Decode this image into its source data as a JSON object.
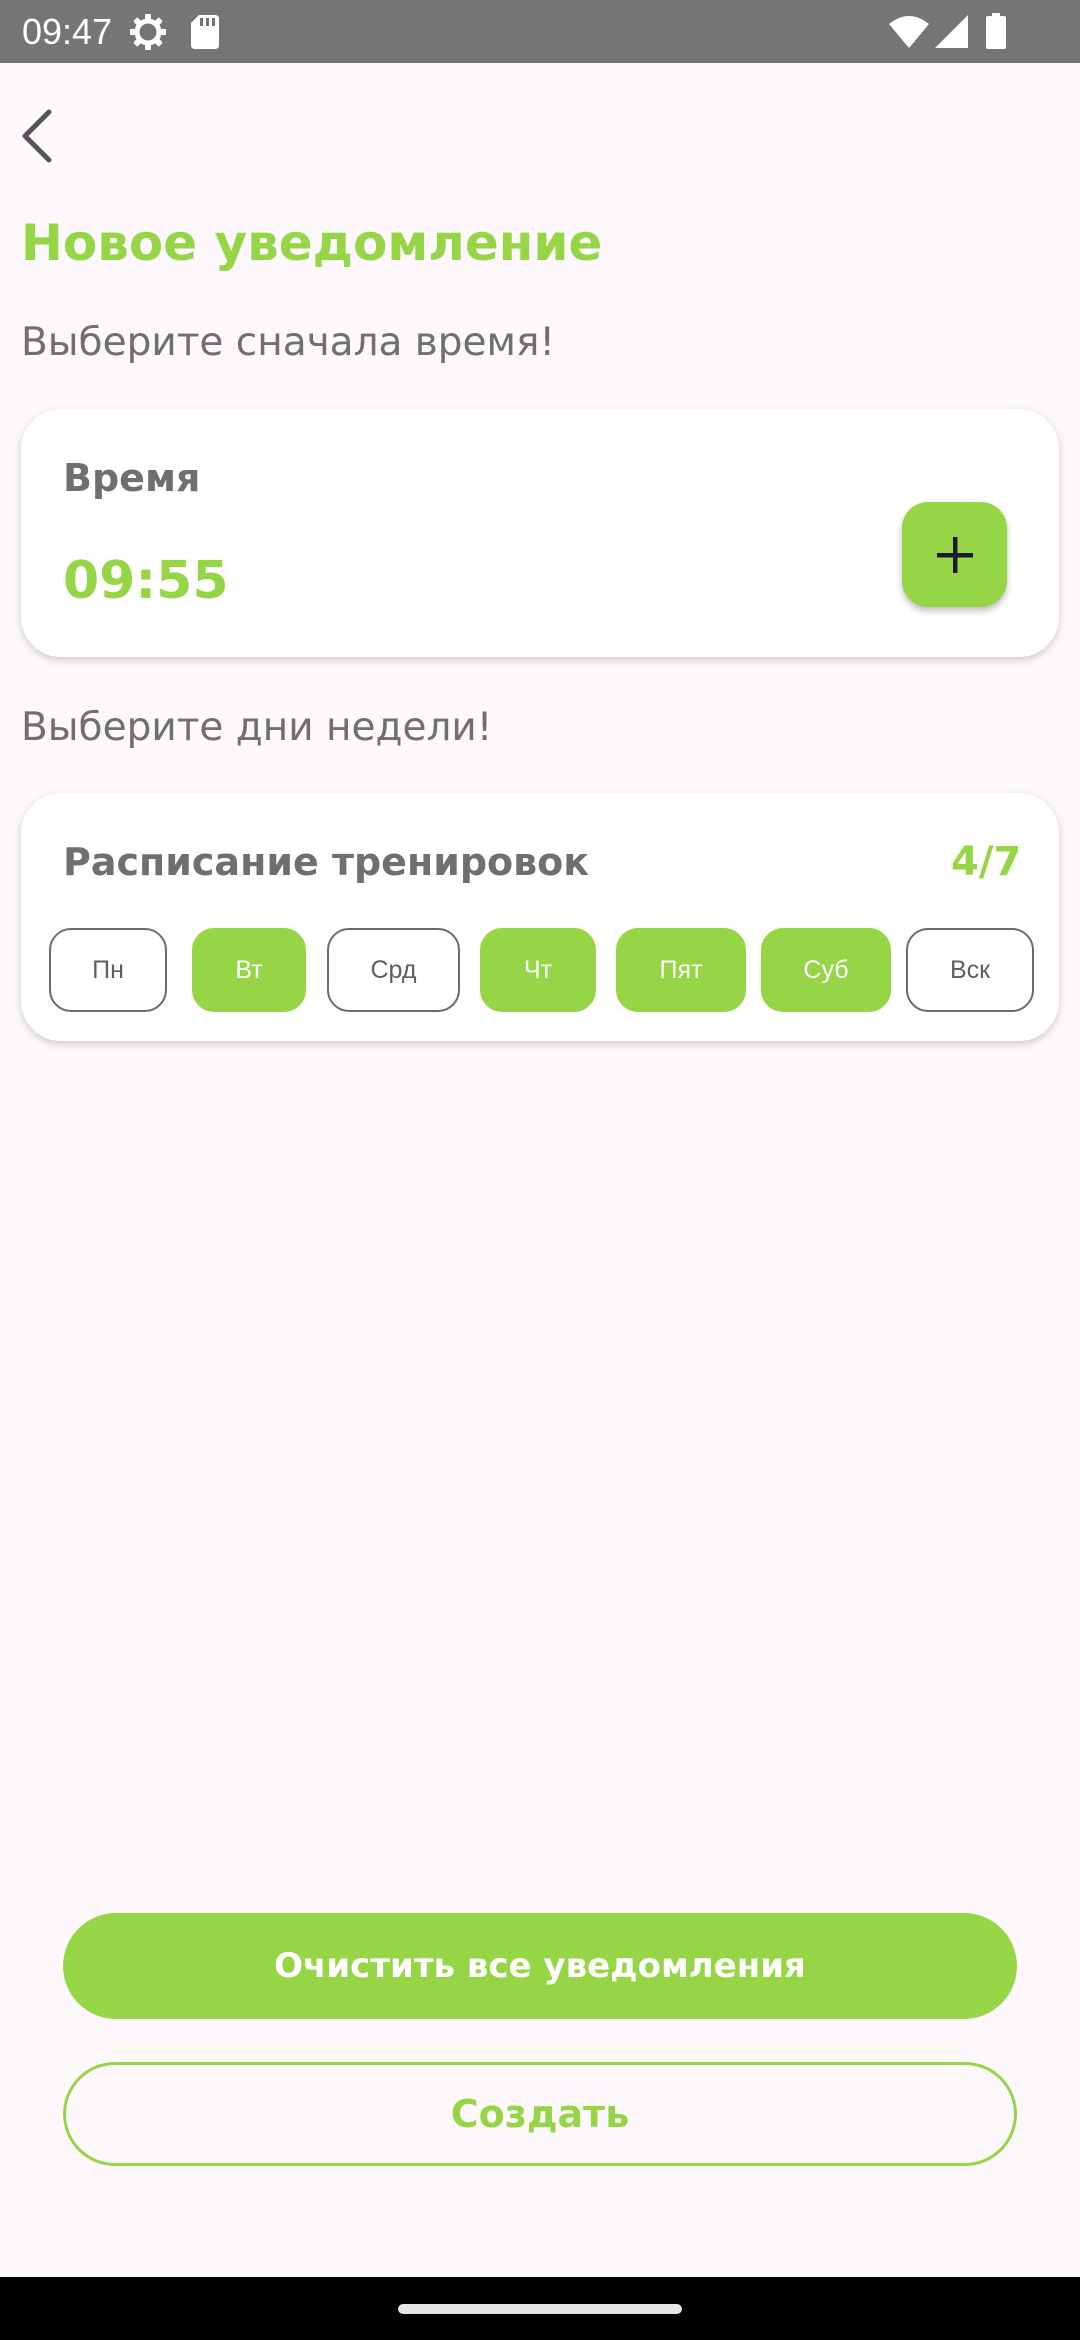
{
  "status_bar": {
    "time": "09:47",
    "icons": [
      "settings-icon",
      "sd-card-icon",
      "wifi-icon",
      "cellular-signal-icon",
      "battery-icon"
    ]
  },
  "header": {
    "back_icon": "chevron-left-icon",
    "title": "Новое уведомление"
  },
  "time_section": {
    "prompt": "Выберите сначала время!",
    "card_heading": "Время",
    "time_value": "09:55",
    "add_icon": "plus-icon"
  },
  "days_section": {
    "prompt": "Выберите дни недели!",
    "card_heading": "Расписание тренировок",
    "counter": "4/7",
    "days": [
      {
        "label": "Пн",
        "selected": false
      },
      {
        "label": "Вт",
        "selected": true
      },
      {
        "label": "Срд",
        "selected": false
      },
      {
        "label": "Чт",
        "selected": true
      },
      {
        "label": "Пят",
        "selected": true
      },
      {
        "label": "Суб",
        "selected": true
      },
      {
        "label": "Вск",
        "selected": false
      }
    ]
  },
  "actions": {
    "clear_label": "Очистить все уведомления",
    "create_label": "Создать"
  },
  "colors": {
    "accent": "#96d646",
    "background": "#fdf8fb",
    "muted_text": "#6f6f6f",
    "status_bar": "#757575"
  }
}
